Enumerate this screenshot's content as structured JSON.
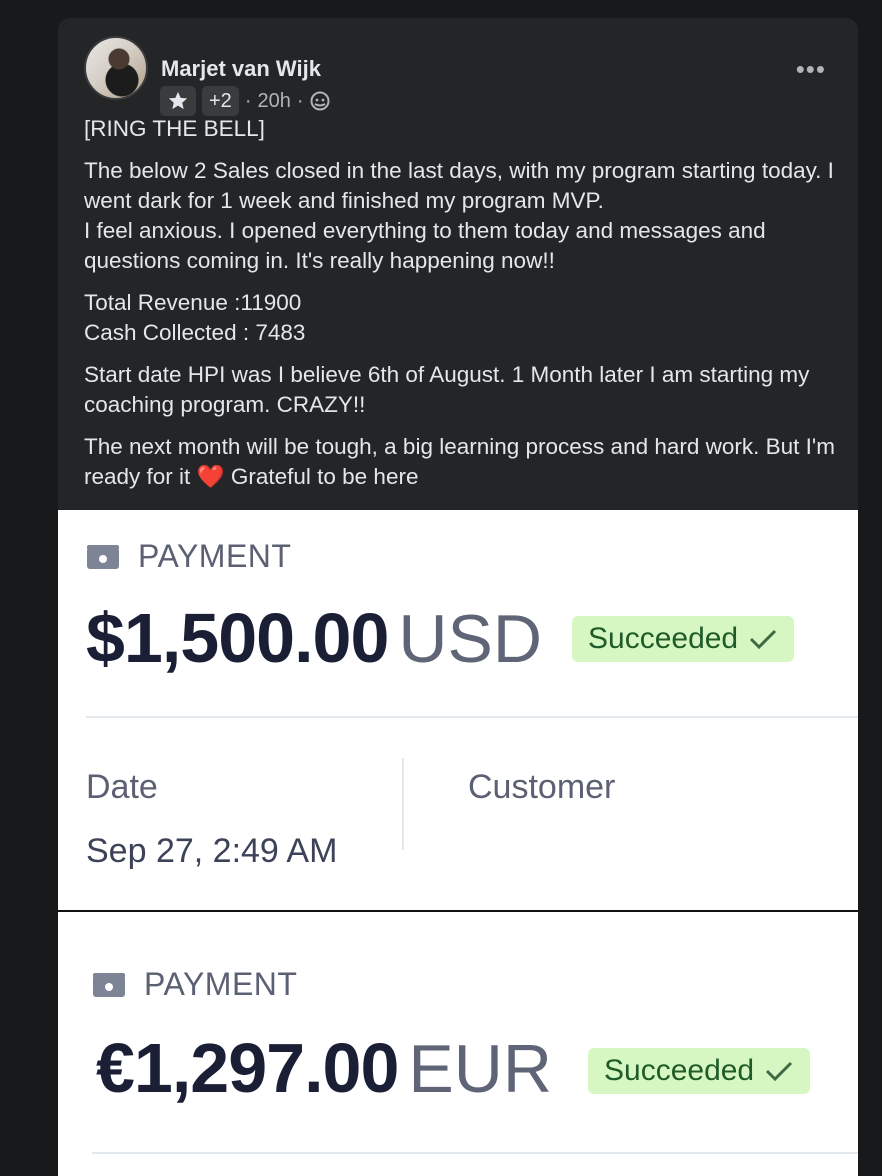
{
  "post": {
    "author": "Marjet van Wijk",
    "badge_count": "+2",
    "time": "20h",
    "dot": "·",
    "more": "•••",
    "title": "[RING THE BELL]",
    "para1_line1": "The below 2 Sales closed in the last days, with my program starting today. I went dark for 1 week and finished my program MVP.",
    "para1_line2": "I feel anxious. I opened everything to them today and messages and questions coming in. It's really happening now!!",
    "revenue": "Total Revenue :11900",
    "cash": "Cash Collected : 7483",
    "para3": "Start date HPI was I believe 6th of August. 1 Month later I am starting my coaching program. CRAZY!!",
    "para4_a": "The next month will be tough, a big learning process and hard work. But I'm ready for it",
    "heart": "❤️",
    "para4_b": "Grateful to be here"
  },
  "payment1": {
    "label": "PAYMENT",
    "amount": "$1,500.00",
    "currency": "USD",
    "status": "Succeeded",
    "date_label": "Date",
    "date_value": "Sep 27, 2:49 AM",
    "customer_label": "Customer"
  },
  "payment2": {
    "label": "PAYMENT",
    "amount": "€1,297.00",
    "currency": "EUR",
    "status": "Succeeded"
  },
  "icons": [
    "star-icon",
    "globe-icon",
    "more-icon",
    "wallet-icon",
    "check-icon",
    "heart-icon"
  ],
  "colors": {
    "post_bg": "#242526",
    "page_bg": "#18191a",
    "status_bg": "#d7f7c2",
    "status_text": "#1f5c2a"
  }
}
